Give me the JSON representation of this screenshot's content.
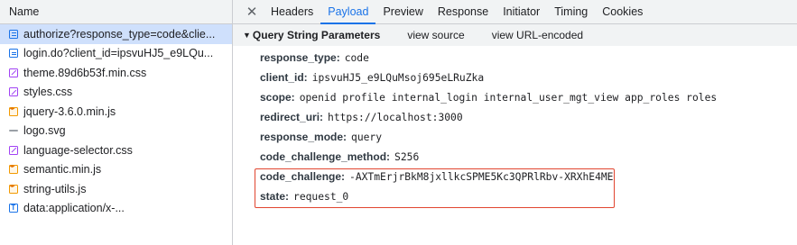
{
  "requests": {
    "column_header": "Name",
    "items": [
      {
        "name": "authorize?response_type=code&clie...",
        "icon": "document-icon",
        "type": "doc",
        "selected": true
      },
      {
        "name": "login.do?client_id=ipsvuHJ5_e9LQu...",
        "icon": "document-icon",
        "type": "doc"
      },
      {
        "name": "theme.89d6b53f.min.css",
        "icon": "stylesheet-icon",
        "type": "css"
      },
      {
        "name": "styles.css",
        "icon": "stylesheet-icon",
        "type": "css"
      },
      {
        "name": "jquery-3.6.0.min.js",
        "icon": "script-icon",
        "type": "js"
      },
      {
        "name": "logo.svg",
        "icon": "image-icon",
        "type": "img"
      },
      {
        "name": "language-selector.css",
        "icon": "stylesheet-icon",
        "type": "css"
      },
      {
        "name": "semantic.min.js",
        "icon": "script-icon",
        "type": "js"
      },
      {
        "name": "string-utils.js",
        "icon": "script-icon",
        "type": "js"
      },
      {
        "name": "data:application/x-...",
        "icon": "text-file-icon",
        "type": "txt"
      }
    ]
  },
  "tabs": {
    "close_symbol": "✕",
    "items": [
      "Headers",
      "Payload",
      "Preview",
      "Response",
      "Initiator",
      "Timing",
      "Cookies"
    ],
    "active": "Payload"
  },
  "section": {
    "arrow": "▼",
    "title": "Query String Parameters",
    "view_source": "view source",
    "view_url_encoded": "view URL-encoded"
  },
  "params": [
    {
      "key": "response_type:",
      "value": "code"
    },
    {
      "key": "client_id:",
      "value": "ipsvuHJ5_e9LQuMsoj695eLRuZka"
    },
    {
      "key": "scope:",
      "value": "openid profile internal_login internal_user_mgt_view app_roles roles"
    },
    {
      "key": "redirect_uri:",
      "value": "https://localhost:3000"
    },
    {
      "key": "response_mode:",
      "value": "query"
    },
    {
      "key": "code_challenge_method:",
      "value": "S256"
    },
    {
      "key": "code_challenge:",
      "value": "-AXTmErjrBkM8jxllkcSPME5Kc3QPRlRbv-XRXhE4ME"
    },
    {
      "key": "state:",
      "value": "request_0"
    }
  ],
  "colors": {
    "accent": "#1a73e8",
    "selected_row": "#cfe0fc",
    "highlight_box": "#e1452f"
  }
}
